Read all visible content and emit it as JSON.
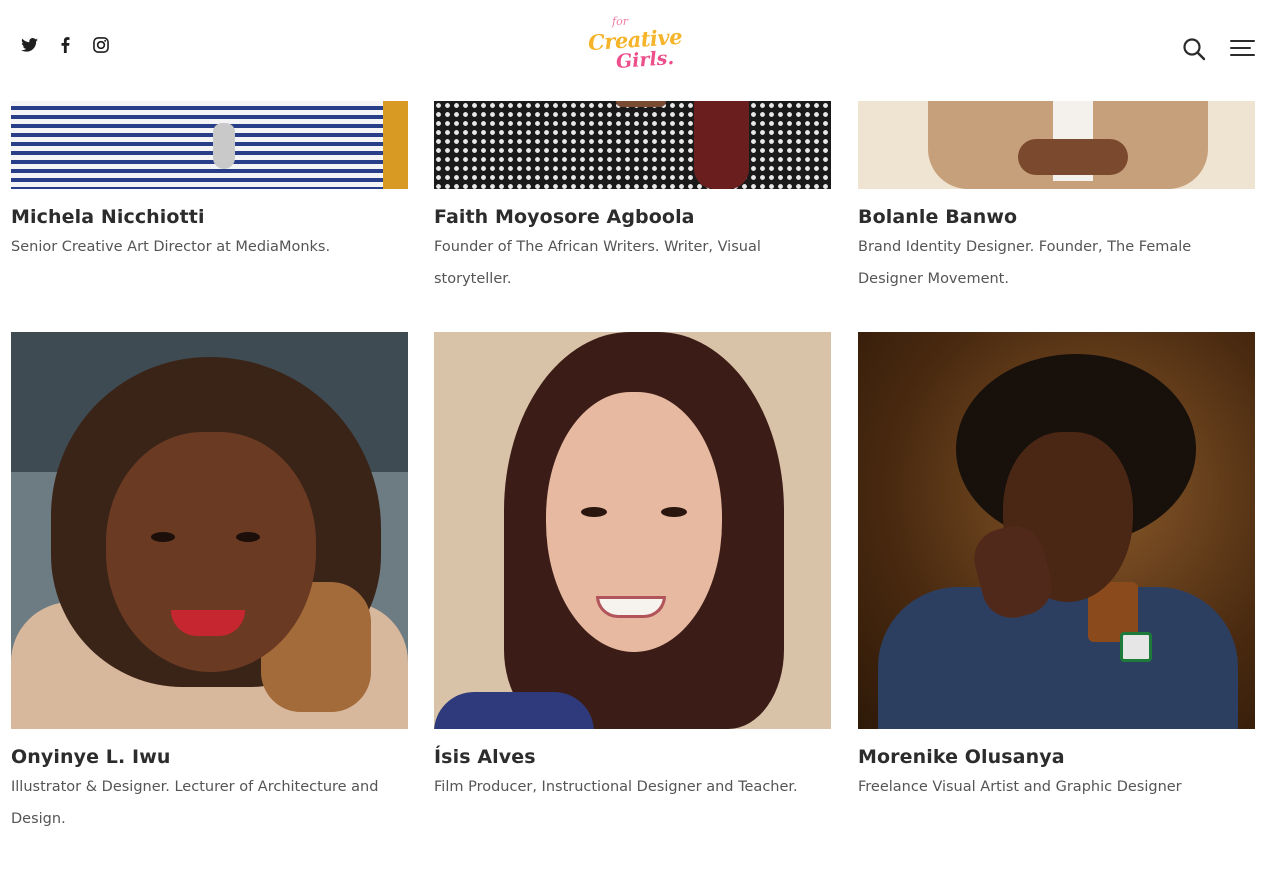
{
  "header": {
    "social": {
      "twitter": "twitter-icon",
      "facebook": "facebook-icon",
      "instagram": "instagram-icon"
    },
    "logo": {
      "for": "for",
      "creative": "Creative",
      "girls": "Girls."
    },
    "search_icon": "search-icon",
    "menu_icon": "menu-icon"
  },
  "colors": {
    "logo_yellow": "#f5b42a",
    "logo_pink": "#ec4f8c",
    "name_text": "#2c2c2c",
    "desc_text": "#555555"
  },
  "people": [
    {
      "name": "Michela Nicchiotti",
      "description": "Senior Creative Art Director at MediaMonks."
    },
    {
      "name": "Faith Moyosore Agboola",
      "description": "Founder of The African Writers. Writer, Visual storyteller."
    },
    {
      "name": "Bolanle Banwo",
      "description": "Brand Identity Designer. Founder, The Female Designer Movement."
    },
    {
      "name": "Onyinye L. Iwu",
      "description": "Illustrator & Designer. Lecturer of Architecture and Design."
    },
    {
      "name": "Ísis Alves",
      "description": "Film Producer, Instructional Designer and Teacher."
    },
    {
      "name": "Morenike Olusanya",
      "description": "Freelance Visual Artist and Graphic Designer"
    }
  ]
}
